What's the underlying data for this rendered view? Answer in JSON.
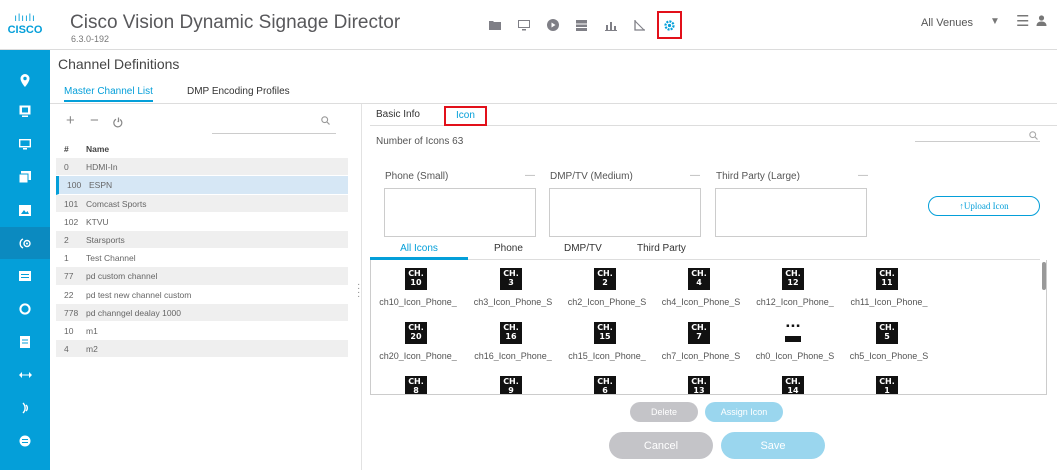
{
  "header": {
    "logo_bars": "ılıılı",
    "logo_text": "CISCO",
    "title": "Cisco Vision Dynamic Signage Director",
    "version": "6.3.0-192",
    "venue": "All Venues",
    "icons": [
      "folder-icon",
      "monitor-icon",
      "play-icon",
      "grid-icon",
      "bar-chart-icon",
      "triangle-ruler-icon",
      "gear-icon"
    ],
    "active_icon": "gear-icon"
  },
  "leftnav": {
    "items": [
      "location-pin-icon",
      "device-icon",
      "display-icon",
      "layers-icon",
      "image-icon",
      "channel-icon",
      "list-icon",
      "circle-icon",
      "document-icon",
      "arrows-icon",
      "broadcast-icon",
      "globe-icon"
    ]
  },
  "page": {
    "title": "Channel Definitions",
    "tabs": [
      "Master Channel List",
      "DMP Encoding Profiles"
    ]
  },
  "channel_list": {
    "columns": [
      "#",
      "Name"
    ],
    "rows": [
      {
        "num": "0",
        "name": "HDMI-In"
      },
      {
        "num": "100",
        "name": "ESPN"
      },
      {
        "num": "101",
        "name": "Comcast Sports"
      },
      {
        "num": "102",
        "name": "KTVU"
      },
      {
        "num": "2",
        "name": "Starsports"
      },
      {
        "num": "1",
        "name": "Test Channel"
      },
      {
        "num": "77",
        "name": "pd custom channel"
      },
      {
        "num": "22",
        "name": "pd test new channel custom"
      },
      {
        "num": "778",
        "name": "pd channgel dealay 1000"
      },
      {
        "num": "10",
        "name": "m1"
      },
      {
        "num": "4",
        "name": "m2"
      }
    ],
    "selected_index": 1
  },
  "detail": {
    "tabs": [
      "Basic Info",
      "Icon"
    ],
    "active_tab": "Icon",
    "icon_count_label": "Number of Icons 63",
    "slots": [
      {
        "label": "Phone (Small)",
        "dash": "—"
      },
      {
        "label": "DMP/TV (Medium)",
        "dash": "—"
      },
      {
        "label": "Third Party (Large)",
        "dash": "—"
      }
    ],
    "upload_label": "↑Upload Icon",
    "filter_tabs": [
      "All Icons",
      "Phone",
      "DMP/TV",
      "Third Party"
    ],
    "icons": [
      {
        "tile": "CH.\n10",
        "caption": "ch10_Icon_Phone_"
      },
      {
        "tile": "CH.\n3",
        "caption": "ch3_Icon_Phone_S"
      },
      {
        "tile": "CH.\n2",
        "caption": "ch2_Icon_Phone_S"
      },
      {
        "tile": "CH.\n4",
        "caption": "ch4_Icon_Phone_S"
      },
      {
        "tile": "CH.\n12",
        "caption": "ch12_Icon_Phone_"
      },
      {
        "tile": "CH.\n11",
        "caption": "ch11_Icon_Phone_"
      },
      {
        "tile": "CH.\n20",
        "caption": "ch20_Icon_Phone_"
      },
      {
        "tile": "CH.\n16",
        "caption": "ch16_Icon_Phone_"
      },
      {
        "tile": "CH.\n15",
        "caption": "ch15_Icon_Phone_"
      },
      {
        "tile": "CH.\n7",
        "caption": "ch7_Icon_Phone_S"
      },
      {
        "tile": "",
        "caption": "ch0_Icon_Phone_S"
      },
      {
        "tile": "CH.\n5",
        "caption": "ch5_Icon_Phone_S"
      },
      {
        "tile": "CH.\n8",
        "caption": ""
      },
      {
        "tile": "CH.\n9",
        "caption": ""
      },
      {
        "tile": "CH.\n6",
        "caption": ""
      },
      {
        "tile": "CH.\n13",
        "caption": ""
      },
      {
        "tile": "CH.\n14",
        "caption": ""
      },
      {
        "tile": "CH.\n1",
        "caption": ""
      }
    ],
    "buttons": {
      "delete": "Delete",
      "assign": "Assign Icon",
      "cancel": "Cancel",
      "save": "Save"
    }
  }
}
